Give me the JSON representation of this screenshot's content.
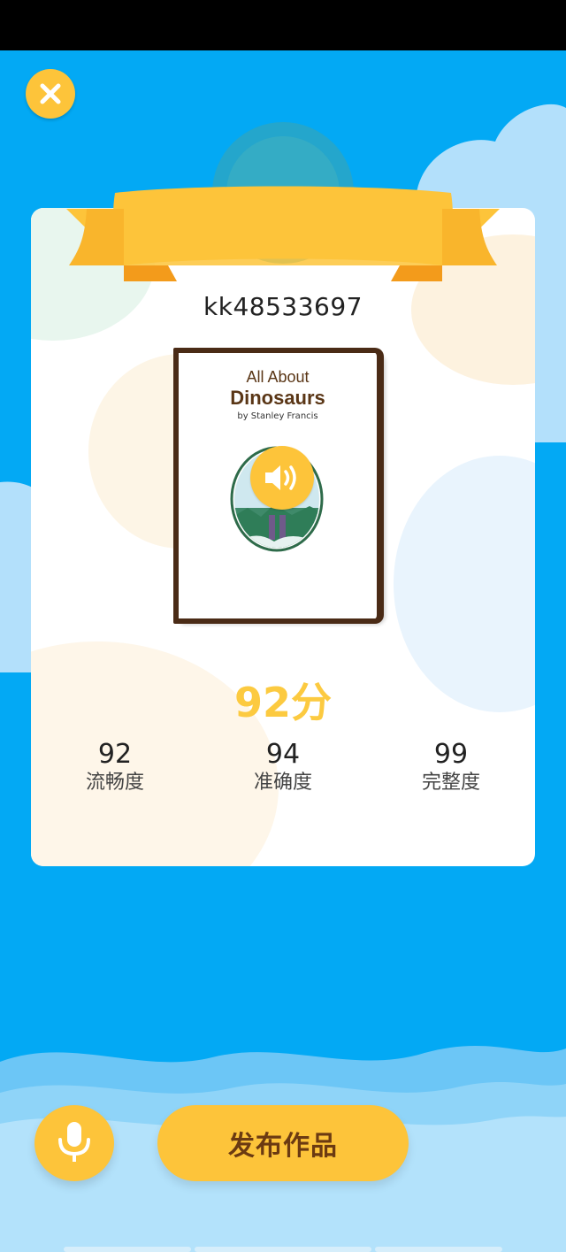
{
  "header": {
    "close_icon": "close-icon"
  },
  "record": {
    "username": "kk48533697",
    "book": {
      "title_line1": "All About",
      "title_line2": "Dinosaurs",
      "author": "by Stanley Francis",
      "play_icon": "speaker-icon"
    },
    "total_score": "92分",
    "metrics": [
      {
        "value": "92",
        "label": "流畅度"
      },
      {
        "value": "94",
        "label": "准确度"
      },
      {
        "value": "99",
        "label": "完整度"
      }
    ]
  },
  "footer": {
    "mic_icon": "microphone-icon",
    "publish_label": "发布作品"
  },
  "colors": {
    "background": "#03a9f4",
    "accent_yellow": "#fdc43a",
    "score_yellow": "#fcca40",
    "button_text_brown": "#6b3a12"
  }
}
